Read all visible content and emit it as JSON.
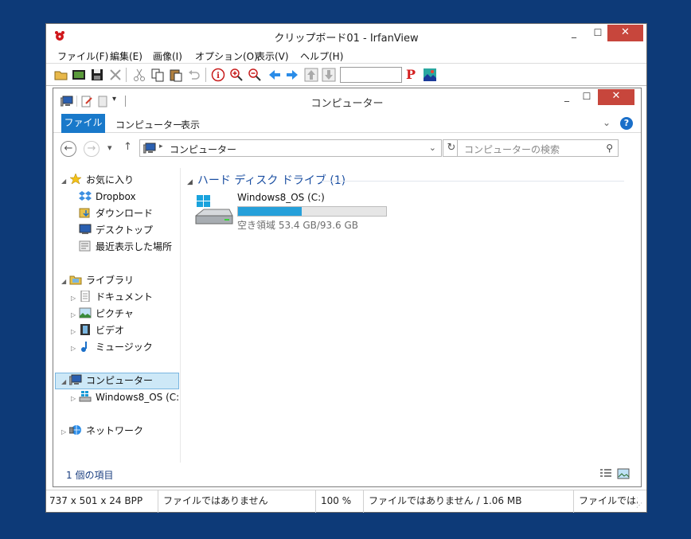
{
  "window": {
    "title": "クリップボード01 - IrfanView",
    "min": "_",
    "max": "☐",
    "close": "✕"
  },
  "menu": [
    "ファイル(F)",
    "編集(E)",
    "画像(I)",
    "オプション(O)",
    "表示(V)",
    "ヘルプ(H)"
  ],
  "toolbar": {
    "page_input": "",
    "p_label": "P"
  },
  "explorer": {
    "title": "コンピューター",
    "min": "_",
    "max": "☐",
    "close": "✕",
    "tabs": [
      "ファイル",
      "コンピューター",
      "表示"
    ],
    "help": "?",
    "address": "コンピューター",
    "search_placeholder": "コンピューターの検索",
    "tree": {
      "favorites": "お気に入り",
      "dropbox": "Dropbox",
      "downloads": "ダウンロード",
      "desktop": "デスクトップ",
      "recent": "最近表示した場所",
      "libraries": "ライブラリ",
      "documents": "ドキュメント",
      "pictures": "ピクチャ",
      "videos": "ビデオ",
      "music": "ミュージック",
      "computer": "コンピューター",
      "drive": "Windows8_OS (C:",
      "network": "ネットワーク"
    },
    "group_header": "ハード ディスク ドライブ (1)",
    "drive": {
      "name": "Windows8_OS (C:)",
      "free_text": "空き領域 53.4 GB/93.6 GB",
      "used_fraction": 0.43
    },
    "status": "1 個の項目"
  },
  "statusbar": [
    "737 x 501 x 24 BPP",
    "ファイルではありません",
    "100 %",
    "ファイルではありません / 1.06 MB",
    "ファイルではあ"
  ],
  "colors": {
    "desktop": "#0d3a78",
    "close": "#c7463c",
    "accent": "#1979ca",
    "progress": "#26a0da"
  }
}
